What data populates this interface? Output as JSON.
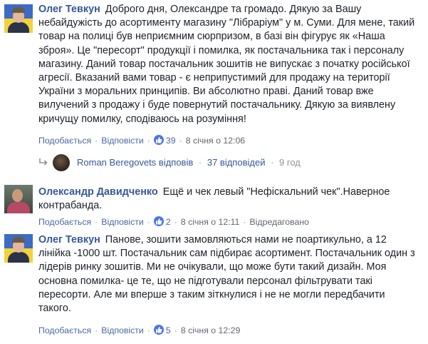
{
  "comments": [
    {
      "author": "Олег Тевкун",
      "text": "Доброго дня, Олександре та громадо. Дякую за Вашу небайдужість до асортименту магазину \"Лібраріум\" у м. Суми. Для мене, такий товар на полиці був неприємним сюрпризом, в базі він фігурує як «Наша зброя». Це \"пересорт\" продукції і помилка, як постачальника так і персоналу магазину. Даний товар постачальник зошитів не випускає з початку російської агресії. Вказаний вами товар - є неприпустимий для продажу на території України з моральних принципів. Ви абсолютно праві. Даний товар вже вилучений з продажу і буде повернутий постачальнику. Дякую за виявлену кричущу помилку, сподіваюсь на розуміння!",
      "like_label": "Подобається",
      "reply_label": "Відповісти",
      "reactions": "39",
      "timestamp": "8 січня о 12:06",
      "edited_label": ""
    },
    {
      "author": "Олександр Давидченко",
      "text": "Ещё и чек левый \"Нефіскальний чек\".Наверное контрабанда.",
      "like_label": "Подобається",
      "reply_label": "Відповісти",
      "reactions": "2",
      "timestamp": "8 січня о 12:11",
      "edited_label": "Відредаговано"
    },
    {
      "author": "Олег Тевкун",
      "text": "Панове, зошити замовляються нами не поартикульно, а 12 лінійка -1000 шт. Постачальник сам підбирає асортимент. Постачальник один з лідерів ринку зошитів. Ми не очікували, що може бути такий дизайн. Моя основна помилка- це те, що не підготували персонал фільтрувати такі пересорти. Але ми вперше з таким зіткнулися і не не могли передбачити такого.",
      "like_label": "Подобається",
      "reply_label": "Відповісти",
      "reactions": "5",
      "timestamp": "8 січня о 12:29",
      "edited_label": ""
    }
  ],
  "replies": {
    "name": "Roman Beregovets",
    "verb": "відповів",
    "count": "37 відповідей",
    "age": "9 год"
  },
  "colors": {
    "link": "#365899",
    "action": "#4b67a1",
    "meta": "#90949c",
    "like_badge": "#4a76e8"
  }
}
